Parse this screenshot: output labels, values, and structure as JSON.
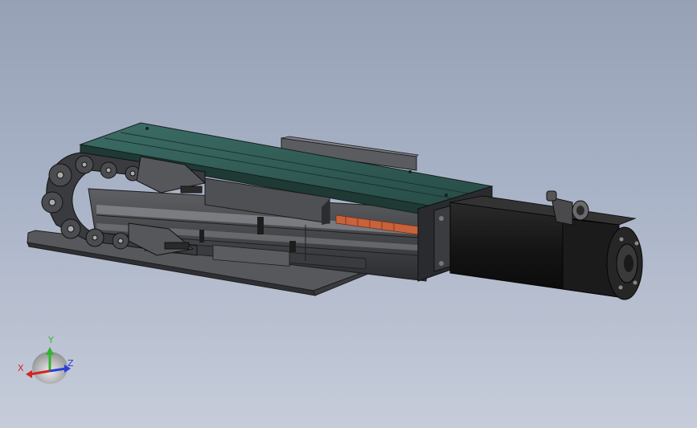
{
  "viewport": {
    "background_top": "#97a1b6",
    "background_bottom": "#c6ccd9"
  },
  "model": {
    "parts": [
      "base-plate",
      "drag-chain",
      "linear-actuator-body",
      "carriage-top-plate",
      "motor-mount-flange",
      "servo-motor",
      "motor-connector"
    ],
    "colors": {
      "top_plate": "#2f5b55",
      "frame": "#4a4b4d",
      "motor": "#161616",
      "ball_screw": "#c8623a"
    }
  },
  "triad": {
    "x_label": "X",
    "y_label": "Y",
    "z_label": "Z",
    "x_color": "#d42424",
    "y_color": "#2fb52f",
    "z_color": "#2b3ed6"
  }
}
